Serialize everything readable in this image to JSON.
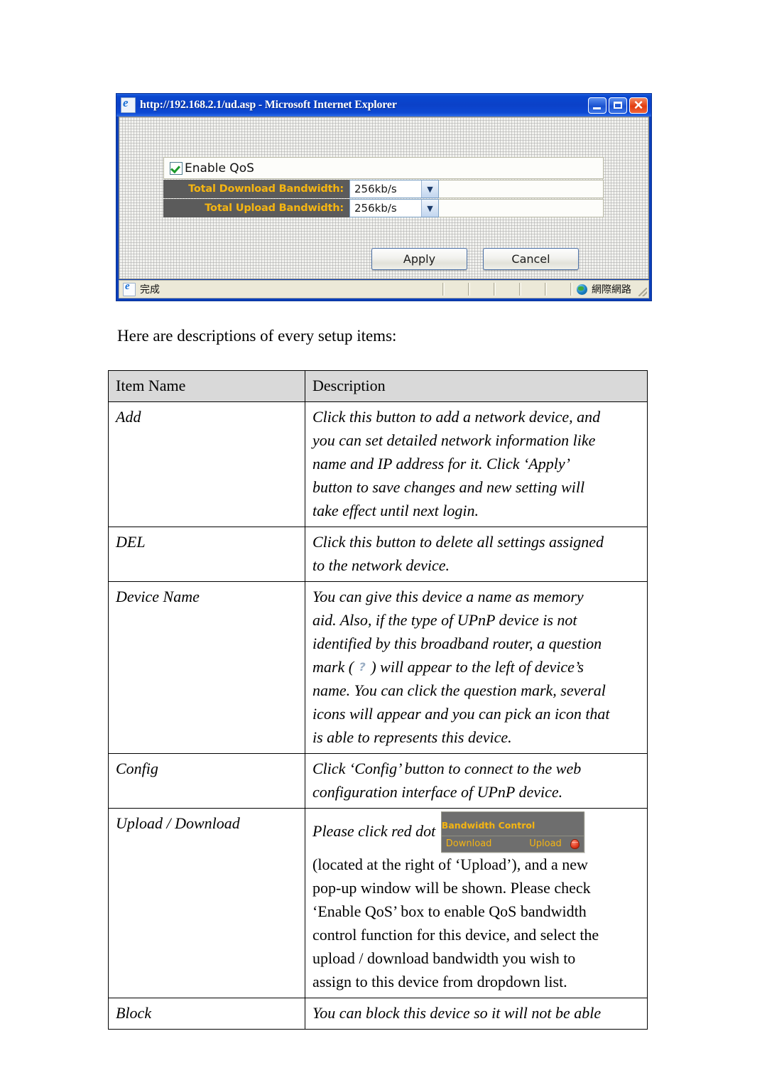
{
  "browser": {
    "title": "http://192.168.2.1/ud.asp - Microsoft Internet Explorer",
    "title_icon": "ie-page-icon",
    "controls": {
      "minimize": "minimize-button",
      "maximize": "maximize-button",
      "close": "close-button"
    },
    "form": {
      "enable_qos_label": "Enable QoS",
      "enable_qos_checked": true,
      "download_label": "Total Download Bandwidth:",
      "download_value": "256kb/s",
      "upload_label": "Total Upload Bandwidth:",
      "upload_value": "256kb/s",
      "apply_label": "Apply",
      "cancel_label": "Cancel",
      "label_color": "#f5b512",
      "label_bg": "#5b5b5b"
    },
    "statusbar": {
      "status_text": "完成",
      "zone_text": "網際網路",
      "zone_icon": "globe-icon"
    }
  },
  "document": {
    "intro": "Here are descriptions of every setup items:",
    "table": {
      "headers": [
        "Item Name",
        "Description"
      ],
      "rows": [
        {
          "item": "Add",
          "item_style": "italic",
          "desc_style": "italic",
          "desc_lines": [
            "Click this button to add a network device, and",
            "you can set detailed network information like",
            "name and IP address for it. Click ‘Apply’",
            "button to save changes and new setting will",
            "take effect until next login."
          ]
        },
        {
          "item": "DEL",
          "item_style": "italic",
          "desc_style": "italic",
          "desc_lines": [
            "Click this button to delete all settings assigned",
            "to the network device."
          ]
        },
        {
          "item": "Device Name",
          "item_style": "italic",
          "desc_style": "italic",
          "desc_lines": [
            "You can give this device a name as memory",
            "aid. Also, if the type of UPnP device is not",
            "identified by this broadband router, a question",
            "__QMARK_LINE__",
            "name. You can click the question mark, several",
            "icons will appear and you can pick an icon that",
            "is able to represents this device."
          ],
          "qmark_line_pre": "mark ( ",
          "qmark_glyph": "?",
          "qmark_line_post": " ) will appear to the left of device’s"
        },
        {
          "item": "Config",
          "item_style": "italic",
          "desc_style": "italic",
          "desc_lines": [
            "Click ‘Config’ button to connect to the web",
            "configuration interface of UPnP device."
          ]
        },
        {
          "item": "Upload / Download",
          "item_style": "italic",
          "desc_style": "mixed",
          "desc_lead_italic": "Please click red dot",
          "widget": {
            "title": "Bandwidth Control",
            "download_label": "Download",
            "upload_label": "Upload",
            "dot": "red-dot-icon",
            "text_color": "#f5b512",
            "bg_color": "#6e6e6e"
          },
          "desc_lines": [
            "(located at the right of ‘Upload’), and a new",
            "pop-up window will be shown. Please check",
            "‘Enable QoS’ box to enable QoS bandwidth",
            "control function for this device, and select the",
            "upload / download bandwidth you wish to",
            "assign to this device from dropdown list."
          ]
        },
        {
          "item": "Block",
          "item_style": "italic",
          "desc_style": "italic",
          "desc_lines": [
            "You can block this device so it will not be able"
          ]
        }
      ]
    }
  }
}
